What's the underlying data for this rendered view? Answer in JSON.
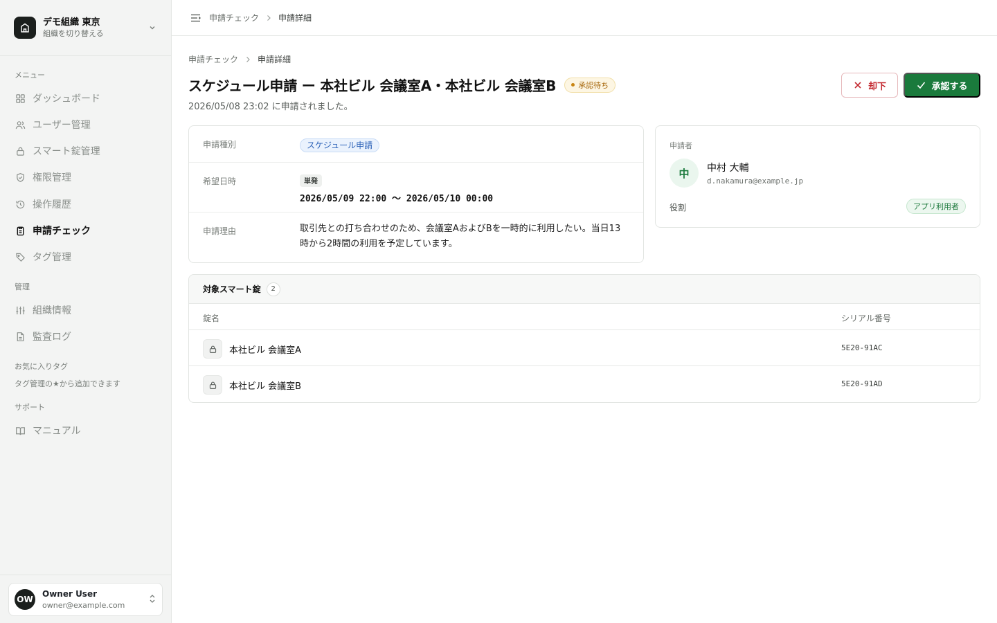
{
  "org": {
    "name": "デモ組織 東京",
    "switch_label": "組織を切り替える"
  },
  "nav": {
    "menu_label": "メニュー",
    "menu_items": [
      {
        "label": "ダッシュボード",
        "icon": "grid-icon"
      },
      {
        "label": "ユーザー管理",
        "icon": "users-icon"
      },
      {
        "label": "スマート錠管理",
        "icon": "lock-icon"
      },
      {
        "label": "権限管理",
        "icon": "shield-icon"
      },
      {
        "label": "操作履歴",
        "icon": "history-icon"
      },
      {
        "label": "申請チェック",
        "icon": "clipboard-icon",
        "active": true
      },
      {
        "label": "タグ管理",
        "icon": "tag-icon"
      }
    ],
    "admin_label": "管理",
    "admin_items": [
      {
        "label": "組織情報",
        "icon": "sliders-icon"
      },
      {
        "label": "監査ログ",
        "icon": "file-icon"
      }
    ],
    "favorites_label": "お気に入りタグ",
    "favorites_hint": "タグ管理の★から追加できます",
    "support_label": "サポート",
    "support_items": [
      {
        "label": "マニュアル",
        "icon": "book-icon"
      }
    ]
  },
  "user": {
    "initials": "OW",
    "name": "Owner User",
    "email": "owner@example.com"
  },
  "breadcrumb": {
    "parent": "申請チェック",
    "current": "申請詳細"
  },
  "page": {
    "title": "スケジュール申請 ー 本社ビル 会議室A・本社ビル 会議室B",
    "status": "承認待ち",
    "submitted": "2026/05/08 23:02 に申請されました。",
    "reject_label": "却下",
    "approve_label": "承認する"
  },
  "details": {
    "type_label": "申請種別",
    "type_value": "スケジュール申請",
    "datetime_label": "希望日時",
    "datetime_kind": "単発",
    "datetime_value": "2026/05/09 22:00 〜 2026/05/10 00:00",
    "reason_label": "申請理由",
    "reason_value": "取引先との打ち合わせのため、会議室AおよびBを一時的に利用したい。当日13時から2時間の利用を予定しています。"
  },
  "applicant": {
    "label": "申請者",
    "initial": "中",
    "name": "中村 大輔",
    "email": "d.nakamura@example.jp",
    "role_label": "役割",
    "role_value": "アプリ利用者"
  },
  "locks": {
    "title": "対象スマート錠",
    "count": "2",
    "col_name": "錠名",
    "col_serial": "シリアル番号",
    "rows": [
      {
        "name": "本社ビル 会議室A",
        "serial": "5E20-91AC"
      },
      {
        "name": "本社ビル 会議室B",
        "serial": "5E20-91AD"
      }
    ]
  },
  "colors": {
    "approve": "#1a7a3c",
    "reject": "#c42b32",
    "pending": "#a86a10"
  }
}
